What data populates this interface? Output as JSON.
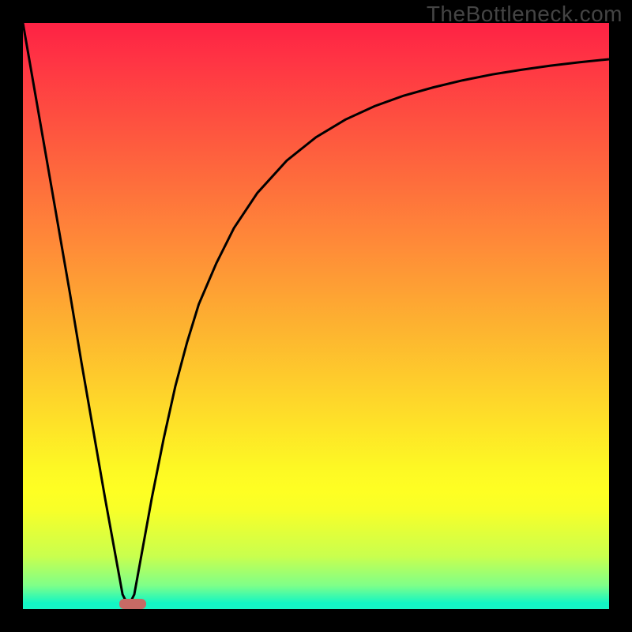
{
  "watermark": "TheBottleneck.com",
  "colors": {
    "curve_stroke": "#000000",
    "bar_fill": "#c76a65",
    "page_bg": "#000000"
  },
  "chart_data": {
    "type": "line",
    "title": "",
    "xlabel": "",
    "ylabel": "",
    "xlim": [
      0,
      100
    ],
    "ylim": [
      0,
      100
    ],
    "series": [
      {
        "name": "bottleneck-curve",
        "x": [
          0,
          2,
          4,
          6,
          8,
          10,
          12,
          14,
          16,
          17,
          18,
          19,
          20,
          22,
          24,
          26,
          28,
          30,
          33,
          36,
          40,
          45,
          50,
          55,
          60,
          65,
          70,
          75,
          80,
          85,
          90,
          95,
          100
        ],
        "y": [
          100,
          88.5,
          77,
          65.5,
          54,
          42,
          30.5,
          19,
          8,
          2.5,
          0.5,
          2.5,
          8,
          19,
          29,
          38,
          45.5,
          52,
          59,
          65,
          71,
          76.5,
          80.5,
          83.5,
          85.8,
          87.6,
          89,
          90.2,
          91.2,
          92,
          92.7,
          93.3,
          93.8
        ]
      }
    ],
    "annotations": [
      {
        "name": "optimal-marker",
        "shape": "bar",
        "x_start": 16.5,
        "x_end": 21,
        "y": 0,
        "height": 1.7
      }
    ]
  }
}
